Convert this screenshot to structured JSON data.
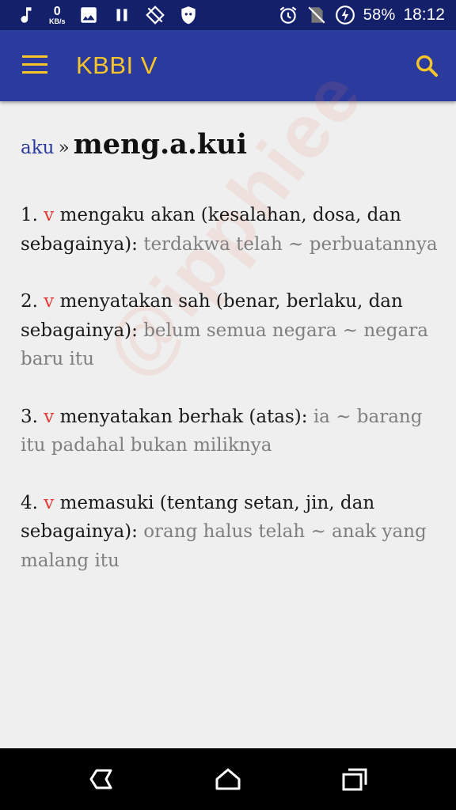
{
  "status_bar": {
    "net_speed_value": "0",
    "net_speed_unit": "KB/s",
    "battery": "58%",
    "time": "18:12",
    "icons_left": [
      "music-note-icon",
      "image-icon",
      "pause-icon",
      "screen-rotation-icon",
      "shield-icon"
    ],
    "icons_right": [
      "alarm-icon",
      "no-sim-icon",
      "battery-charging-icon"
    ]
  },
  "app_bar": {
    "title": "KBBI V",
    "menu_icon": "menu-icon",
    "search_icon": "search-icon",
    "color_bg": "#2b3a9d",
    "color_accent": "#f7c52a"
  },
  "entry": {
    "root": "aku",
    "separator": "»",
    "headword": "meng.a.kui",
    "definitions": [
      {
        "number": "1.",
        "class": "v",
        "text": "mengaku akan (kesalahan, dosa, dan sebagainya):",
        "example": "terdakwa telah ~ perbuatannya"
      },
      {
        "number": "2.",
        "class": "v",
        "text": "menyatakan sah (benar, berlaku, dan sebagainya):",
        "example": "belum semua negara ~ negara baru itu"
      },
      {
        "number": "3.",
        "class": "v",
        "text": "menyatakan berhak (atas):",
        "example": "ia ~ barang itu padahal bukan miliknya"
      },
      {
        "number": "4.",
        "class": "v",
        "text": "memasuki (tentang setan, jin, dan sebagainya):",
        "example": "orang halus telah ~ anak yang malang itu"
      }
    ]
  },
  "watermark": "@ipphiee",
  "nav_bar": {
    "back_icon": "back-icon",
    "home_icon": "home-icon",
    "recents_icon": "recents-icon"
  }
}
